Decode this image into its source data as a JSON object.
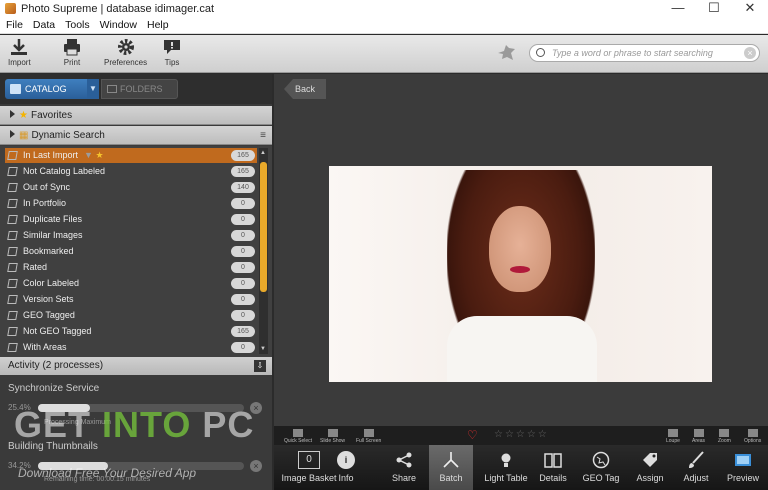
{
  "window": {
    "title": "Photo Supreme | database idimager.cat",
    "minimize": "—",
    "maximize": "☐",
    "close": "✕"
  },
  "menu": [
    "File",
    "Data",
    "Tools",
    "Window",
    "Help"
  ],
  "toolbar": {
    "import": "Import",
    "print": "Print",
    "preferences": "Preferences",
    "tips": "Tips"
  },
  "search": {
    "placeholder": "Type a word or phrase to start searching"
  },
  "tabs": {
    "catalog": "CATALOG",
    "folders": "FOLDERS"
  },
  "sections": {
    "favorites": "Favorites",
    "dynamic_search": "Dynamic Search"
  },
  "items": [
    {
      "label": "In Last Import",
      "count": "165"
    },
    {
      "label": "Not Catalog Labeled",
      "count": "165"
    },
    {
      "label": "Out of Sync",
      "count": "140"
    },
    {
      "label": "In Portfolio",
      "count": "0"
    },
    {
      "label": "Duplicate Files",
      "count": "0"
    },
    {
      "label": "Similar Images",
      "count": "0"
    },
    {
      "label": "Bookmarked",
      "count": "0"
    },
    {
      "label": "Rated",
      "count": "0"
    },
    {
      "label": "Color Labeled",
      "count": "0"
    },
    {
      "label": "Version Sets",
      "count": "0"
    },
    {
      "label": "GEO Tagged",
      "count": "0"
    },
    {
      "label": "Not GEO Tagged",
      "count": "165"
    },
    {
      "label": "With Areas",
      "count": "0"
    }
  ],
  "activity": {
    "title": "Activity (2 processes)",
    "processes": [
      {
        "name": "Synchronize Service",
        "percent": "25.4%",
        "progress": 0.25,
        "detail": "Processing Maximum"
      },
      {
        "name": "Building Thumbnails",
        "percent": "34.2%",
        "progress": 0.34,
        "detail": "Remaining time: 00:00:15 minutes"
      }
    ]
  },
  "watermark": {
    "get": "GET ",
    "into": "INTO",
    "pc": " PC",
    "tagline": "Download Free Your Desired App"
  },
  "viewer": {
    "back": "Back"
  },
  "mini_tools_left": [
    "Quick Select",
    "Slide Show",
    "Full Screen"
  ],
  "mini_tools_right": [
    "Loupe",
    "Areas",
    "Zoom",
    "Options"
  ],
  "rating": {
    "heart": "♡",
    "stars": "☆☆☆☆☆"
  },
  "bottom_buttons": [
    "Image Basket",
    "Info",
    "Share",
    "Batch",
    "Light Table",
    "Details",
    "GEO Tag",
    "Assign",
    "Adjust",
    "Preview"
  ],
  "basket_count": "0"
}
